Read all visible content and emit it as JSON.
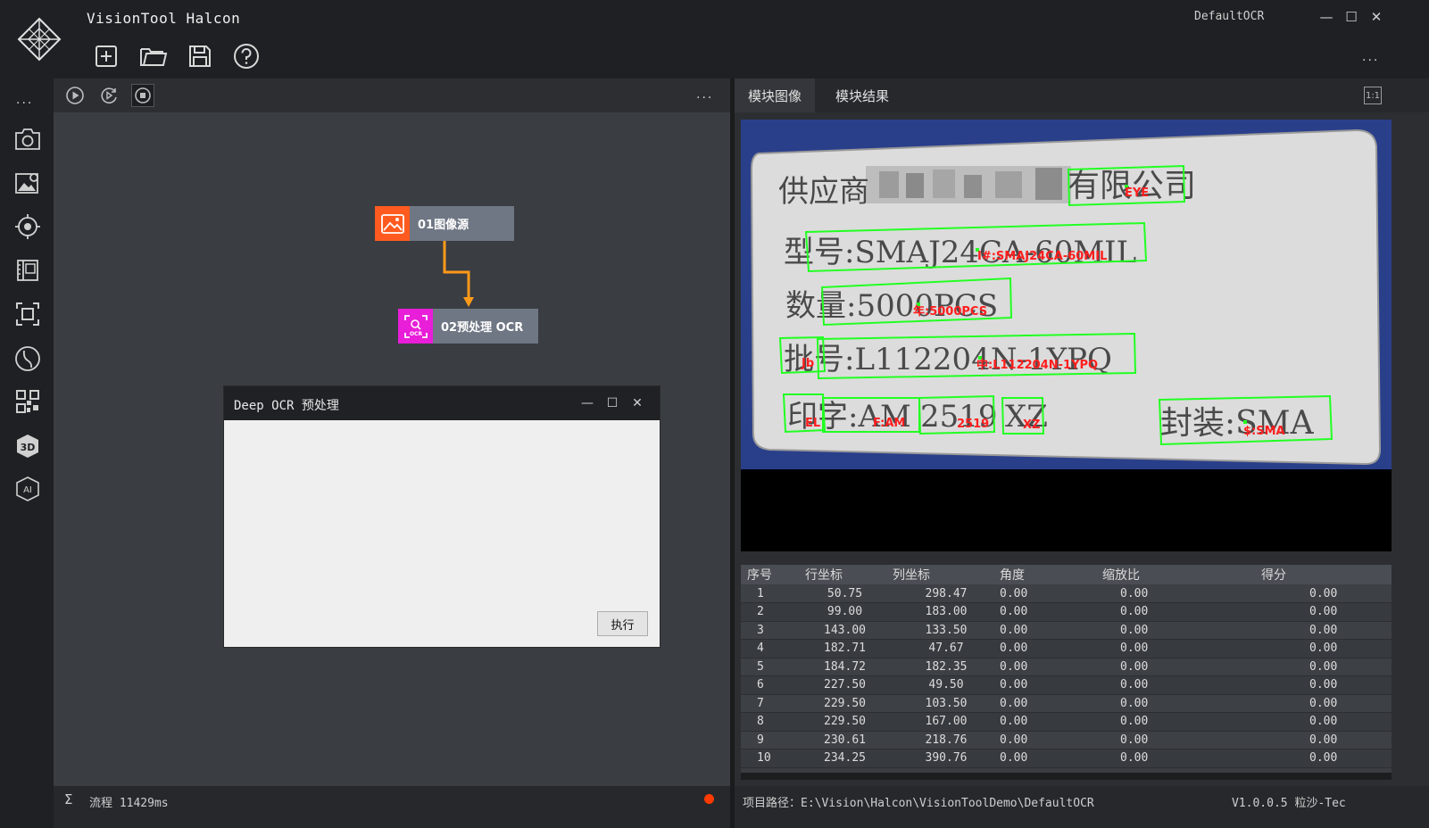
{
  "app": {
    "title": "VisionTool Halcon",
    "project_name": "DefaultOCR"
  },
  "window_controls": {
    "minimize": "—",
    "maximize": "☐",
    "close": "✕"
  },
  "toolbar": {
    "items": [
      "new-file",
      "open-folder",
      "save",
      "help"
    ]
  },
  "sidebar": {
    "more": "...",
    "items": [
      "camera",
      "image-enhance",
      "locate",
      "measure",
      "focus",
      "curve",
      "qrcode",
      "3d",
      "ai"
    ]
  },
  "flow": {
    "more": "...",
    "nodes": [
      {
        "label": "01图像源",
        "color": "#ff5a1f"
      },
      {
        "label": "02预处理 OCR",
        "color": "#e81ed8"
      }
    ],
    "connector_color": "#ff9a1a"
  },
  "dialog": {
    "title": "Deep OCR 预处理",
    "controls": {
      "minimize": "—",
      "maximize": "☐",
      "close": "✕"
    },
    "exec_label": "执行"
  },
  "status_left": {
    "sigma": "Σ",
    "flow_time": "流程 11429ms",
    "status_color": "#ff3a00"
  },
  "tabs": [
    {
      "label": "模块图像",
      "active": true
    },
    {
      "label": "模块结果",
      "active": false
    }
  ],
  "fit_label": "1:1",
  "image": {
    "label_lines": [
      {
        "text": "供应商",
        "blur": true
      },
      {
        "text": "有限公司"
      },
      {
        "text": "型号:SMAJ24CA-60MIL"
      },
      {
        "text": "数量:5000PCS"
      },
      {
        "text": "批号:L112204N-1YPQ"
      },
      {
        "text": "印字:AM"
      },
      {
        "text": "2519"
      },
      {
        "text": "XZ"
      },
      {
        "text": "封装:SMA"
      }
    ],
    "ocr_results": [
      "EYE",
      "I#:SMAJ24CA-60MIL",
      "年:5000PCS",
      "Jb",
      "中:L112204N-1YPQ",
      "EL",
      "F:AM",
      "2519",
      "XZ",
      "$:SMA"
    ],
    "box_color": "#22ff22",
    "text_color": "#ff1e1e"
  },
  "results": {
    "columns": [
      "序号",
      "行坐标",
      "列坐标",
      "角度",
      "缩放比",
      "得分"
    ],
    "rows": [
      [
        "1",
        "50.75",
        "298.47",
        "0.00",
        "0.00",
        "0.00"
      ],
      [
        "2",
        "99.00",
        "183.00",
        "0.00",
        "0.00",
        "0.00"
      ],
      [
        "3",
        "143.00",
        "133.50",
        "0.00",
        "0.00",
        "0.00"
      ],
      [
        "4",
        "182.71",
        "47.67",
        "0.00",
        "0.00",
        "0.00"
      ],
      [
        "5",
        "184.72",
        "182.35",
        "0.00",
        "0.00",
        "0.00"
      ],
      [
        "6",
        "227.50",
        "49.50",
        "0.00",
        "0.00",
        "0.00"
      ],
      [
        "7",
        "229.50",
        "103.50",
        "0.00",
        "0.00",
        "0.00"
      ],
      [
        "8",
        "229.50",
        "167.00",
        "0.00",
        "0.00",
        "0.00"
      ],
      [
        "9",
        "230.61",
        "218.76",
        "0.00",
        "0.00",
        "0.00"
      ],
      [
        "10",
        "234.25",
        "390.76",
        "0.00",
        "0.00",
        "0.00"
      ]
    ]
  },
  "status_right": {
    "project_path": "项目路径：E:\\Vision\\Halcon\\VisionToolDemo\\DefaultOCR",
    "version": "V1.0.0.5 粒沙-Tec"
  }
}
